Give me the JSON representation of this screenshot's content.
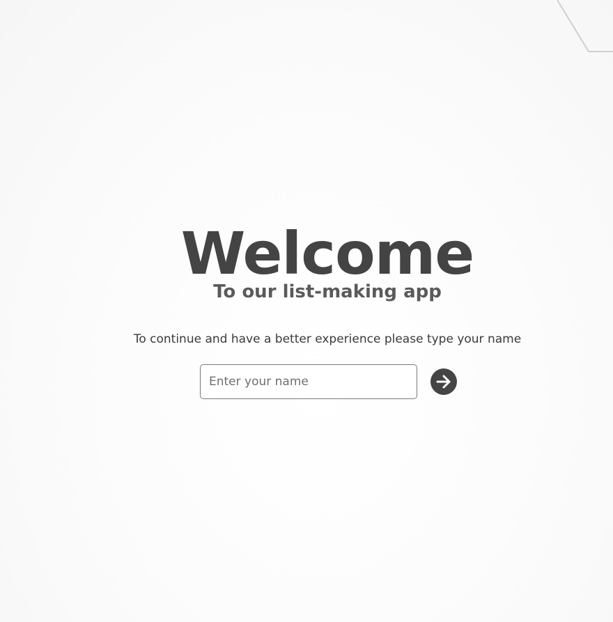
{
  "welcome": {
    "title": "Welcome",
    "subtitle": "To our list-making app",
    "instruction": "To continue and have a better experience please type your name"
  },
  "form": {
    "name_placeholder": "Enter your name",
    "name_value": "",
    "submit_icon": "arrow-right-icon"
  },
  "colors": {
    "text_dark": "#444444",
    "subtitle": "#5a5a5a",
    "button_bg": "#454545",
    "button_icon": "#ffffff",
    "input_border": "#7a7a7a"
  }
}
